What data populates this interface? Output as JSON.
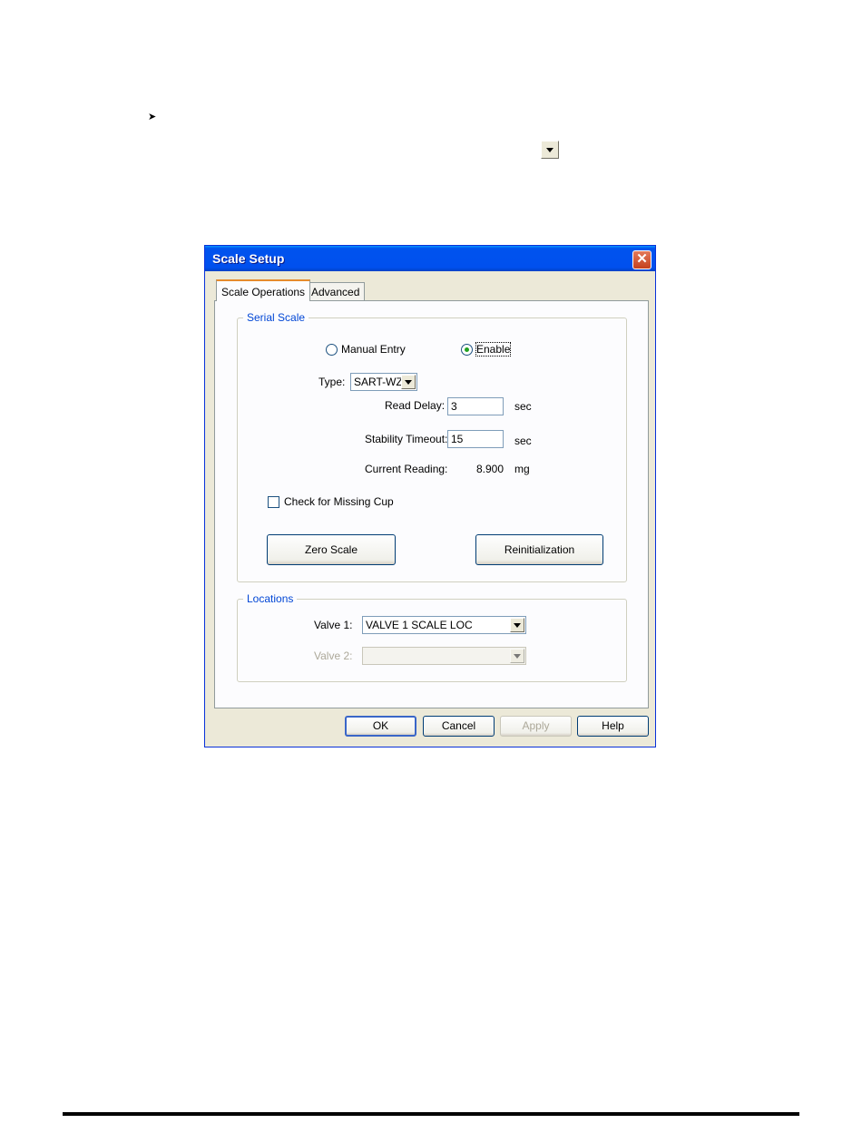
{
  "page": {
    "bullet": "➤"
  },
  "dialog": {
    "title": "Scale Setup",
    "close_glyph": "✕",
    "tabs": [
      {
        "label": "Scale Operations",
        "active": true
      },
      {
        "label": "Advanced",
        "active": false
      }
    ],
    "serial_scale": {
      "legend": "Serial Scale",
      "mode_options": [
        {
          "label": "Manual Entry",
          "selected": false
        },
        {
          "label": "Enable",
          "selected": true
        }
      ],
      "type_label": "Type:",
      "type_value": "SART-WZ",
      "read_delay_label": "Read Delay:",
      "read_delay_value": "3",
      "read_delay_unit": "sec",
      "stability_timeout_label": "Stability Timeout:",
      "stability_timeout_value": "15",
      "stability_timeout_unit": "sec",
      "current_reading_label": "Current Reading:",
      "current_reading_value": "8.900",
      "current_reading_unit": "mg",
      "missing_cup_label": "Check for Missing Cup",
      "missing_cup_checked": false,
      "zero_scale_label": "Zero Scale",
      "reinit_label": "Reinitialization"
    },
    "locations": {
      "legend": "Locations",
      "valve1_label": "Valve 1:",
      "valve1_value": "VALVE 1 SCALE LOC",
      "valve2_label": "Valve 2:",
      "valve2_value": ""
    },
    "buttons": {
      "ok": "OK",
      "cancel": "Cancel",
      "apply": "Apply",
      "help": "Help"
    }
  }
}
